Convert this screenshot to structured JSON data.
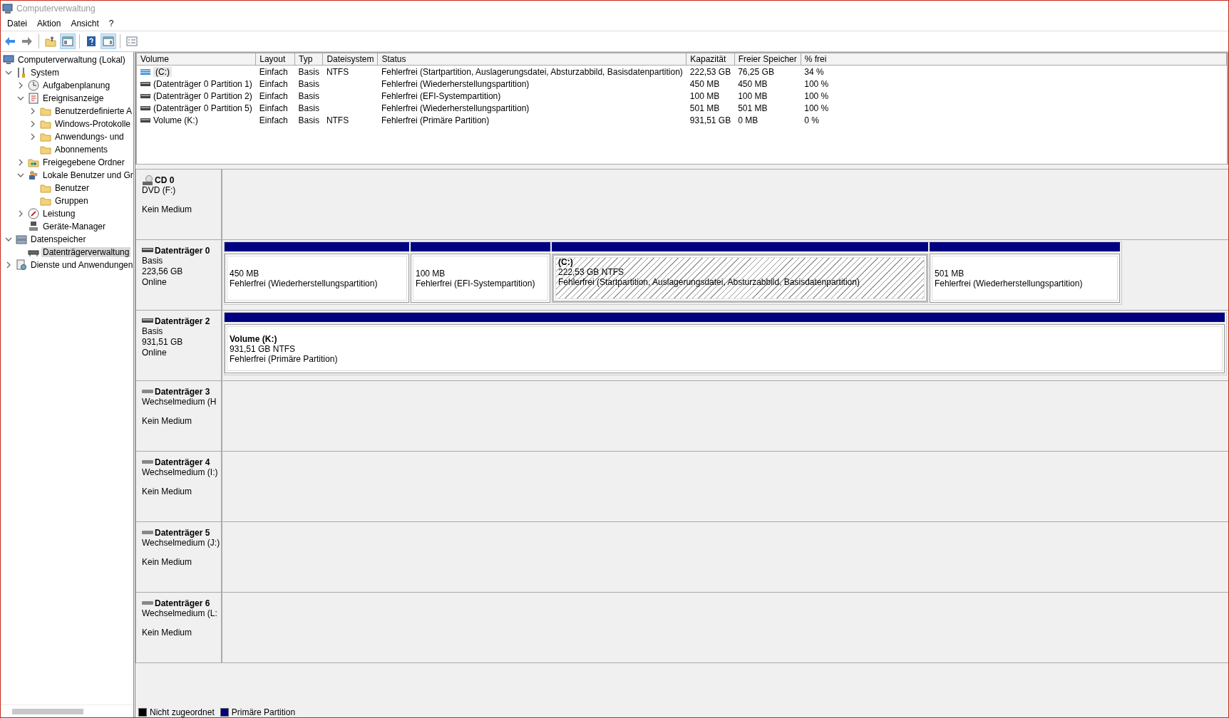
{
  "window": {
    "title": "Computerverwaltung"
  },
  "menu": [
    "Datei",
    "Aktion",
    "Ansicht",
    "?"
  ],
  "toolbar": [
    {
      "kind": "back",
      "pressed": false
    },
    {
      "kind": "forward",
      "pressed": false
    },
    {
      "kind": "sep"
    },
    {
      "kind": "up",
      "pressed": false
    },
    {
      "kind": "tree",
      "pressed": true
    },
    {
      "kind": "sep"
    },
    {
      "kind": "help",
      "pressed": false
    },
    {
      "kind": "pane",
      "pressed": true
    },
    {
      "kind": "sep"
    },
    {
      "kind": "props",
      "pressed": false
    }
  ],
  "tree": [
    {
      "label": "Computerverwaltung (Lokal)",
      "kind": "computer",
      "selected": false,
      "children": [
        {
          "label": "System",
          "kind": "tools",
          "selected": false,
          "expanded": true,
          "children": [
            {
              "label": "Aufgabenplanung",
              "kind": "clock",
              "selected": false,
              "expanded": false
            },
            {
              "label": "Ereignisanzeige",
              "kind": "log",
              "selected": false,
              "expanded": true,
              "children": [
                {
                  "label": "Benutzerdefinierte A",
                  "kind": "folder",
                  "selected": false,
                  "expanded": false
                },
                {
                  "label": "Windows-Protokolle",
                  "kind": "folder",
                  "selected": false,
                  "expanded": false
                },
                {
                  "label": "Anwendungs- und",
                  "kind": "folder",
                  "selected": false,
                  "expanded": false
                },
                {
                  "label": "Abonnements",
                  "kind": "folder",
                  "selected": false
                }
              ]
            },
            {
              "label": "Freigegebene Ordner",
              "kind": "share",
              "selected": false,
              "expanded": false
            },
            {
              "label": "Lokale Benutzer und Gr",
              "kind": "users",
              "selected": false,
              "expanded": true,
              "children": [
                {
                  "label": "Benutzer",
                  "kind": "folder",
                  "selected": false
                },
                {
                  "label": "Gruppen",
                  "kind": "folder",
                  "selected": false
                }
              ]
            },
            {
              "label": "Leistung",
              "kind": "gauge",
              "selected": false,
              "expanded": false
            },
            {
              "label": "Geräte-Manager",
              "kind": "device",
              "selected": false
            }
          ]
        },
        {
          "label": "Datenspeicher",
          "kind": "storage",
          "selected": false,
          "expanded": true,
          "children": [
            {
              "label": "Datenträgerverwaltung",
              "kind": "disk",
              "selected": true
            }
          ]
        },
        {
          "label": "Dienste und Anwendungen",
          "kind": "services",
          "selected": false,
          "expanded": false
        }
      ]
    }
  ],
  "table": {
    "columns": [
      "Volume",
      "Layout",
      "Typ",
      "Dateisystem",
      "Status",
      "Kapazität",
      "Freier Speicher",
      "% frei"
    ],
    "rows": [
      {
        "kind": "system",
        "selected": true,
        "cells": [
          "(C:)",
          "Einfach",
          "Basis",
          "NTFS",
          "Fehlerfrei (Startpartition, Auslagerungsdatei, Absturzabbild, Basisdatenpartition)",
          "222,53 GB",
          "76,25 GB",
          "34 %"
        ]
      },
      {
        "kind": "disk",
        "selected": false,
        "cells": [
          "(Datenträger 0 Partition 1)",
          "Einfach",
          "Basis",
          "",
          "Fehlerfrei (Wiederherstellungspartition)",
          "450 MB",
          "450 MB",
          "100 %"
        ]
      },
      {
        "kind": "disk",
        "selected": false,
        "cells": [
          "(Datenträger 0 Partition 2)",
          "Einfach",
          "Basis",
          "",
          "Fehlerfrei (EFI-Systempartition)",
          "100 MB",
          "100 MB",
          "100 %"
        ]
      },
      {
        "kind": "disk",
        "selected": false,
        "cells": [
          "(Datenträger 0 Partition 5)",
          "Einfach",
          "Basis",
          "",
          "Fehlerfrei (Wiederherstellungspartition)",
          "501 MB",
          "501 MB",
          "100 %"
        ]
      },
      {
        "kind": "disk",
        "selected": false,
        "cells": [
          "Volume (K:)",
          "Einfach",
          "Basis",
          "NTFS",
          "Fehlerfrei (Primäre Partition)",
          "931,51 GB",
          "0 MB",
          "0 %"
        ]
      }
    ]
  },
  "disks": [
    {
      "kind": "cd",
      "name": "CD 0",
      "lines": [
        "DVD (F:)"
      ],
      "status": "Kein Medium"
    },
    {
      "kind": "disk",
      "name": "Datenträger 0",
      "lines": [
        "Basis",
        "223,56 GB",
        "Online"
      ],
      "partitions": [
        {
          "size": "450 MB",
          "status": "Fehlerfrei (Wiederherstellungspartition)",
          "selected": false
        },
        {
          "size": "100 MB",
          "status": "Fehlerfrei (EFI-Systempartition)",
          "selected": false
        },
        {
          "label": "(C:)",
          "size": "222,53 GB NTFS",
          "status": "Fehlerfrei (Startpartition, Auslagerungsdatei, Absturzabbild, Basisdatenpartition)",
          "selected": true
        },
        {
          "size": "501 MB",
          "status": "Fehlerfrei (Wiederherstellungspartition)",
          "selected": false
        }
      ]
    },
    {
      "kind": "disk",
      "name": "Datenträger 2",
      "lines": [
        "Basis",
        "931,51 GB",
        "Online"
      ],
      "partitions": [
        {
          "label": "Volume  (K:)",
          "size": "931,51 GB NTFS",
          "status": "Fehlerfrei (Primäre Partition)",
          "selected": false
        }
      ]
    },
    {
      "kind": "removable",
      "name": "Datenträger 3",
      "lines": [
        "Wechselmedium (H"
      ],
      "status": "Kein Medium"
    },
    {
      "kind": "removable",
      "name": "Datenträger 4",
      "lines": [
        "Wechselmedium (I:)"
      ],
      "status": "Kein Medium"
    },
    {
      "kind": "removable",
      "name": "Datenträger 5",
      "lines": [
        "Wechselmedium (J:)"
      ],
      "status": "Kein Medium"
    },
    {
      "kind": "removable",
      "name": "Datenträger 6",
      "lines": [
        "Wechselmedium (L:"
      ],
      "status": "Kein Medium"
    }
  ],
  "legend": [
    {
      "label": "Nicht zugeordnet",
      "color": "#000000"
    },
    {
      "label": "Primäre Partition",
      "color": "#000080"
    }
  ]
}
